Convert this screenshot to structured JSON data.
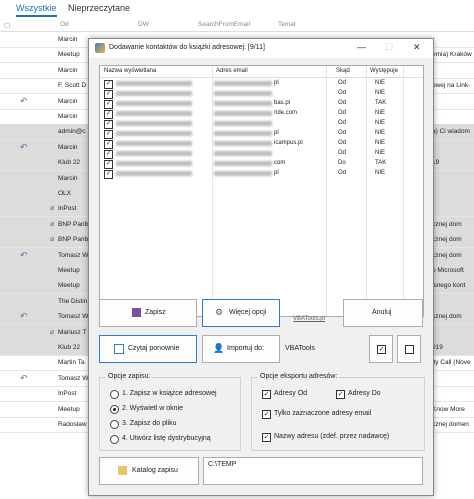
{
  "tabs": {
    "all": "Wszystkie",
    "unread": "Nieprzeczytane"
  },
  "columns": {
    "from": "Od",
    "to": "DW",
    "search_from": "SearchFromEmail",
    "subject": "Temat"
  },
  "rows": [
    {
      "who": "Marcin",
      "right": "",
      "reply": false,
      "clip": false,
      "sel": false
    },
    {
      "who": "Meetup",
      "right": "emia) Kraków",
      "reply": false,
      "clip": false,
      "sel": false
    },
    {
      "who": "Marcin",
      "right": "",
      "reply": false,
      "clip": false,
      "sel": false
    },
    {
      "who": "F. Scott D",
      "right": "owej na Link-",
      "reply": false,
      "clip": false,
      "sel": false
    },
    {
      "who": "Marcin",
      "right": "",
      "reply": true,
      "clip": false,
      "sel": false
    },
    {
      "who": "Marcin",
      "right": "",
      "reply": false,
      "clip": false,
      "sel": false
    },
    {
      "who": "admin@c",
      "right": "a) Ci wiadom",
      "reply": false,
      "clip": false,
      "sel": true
    },
    {
      "who": "Marcin",
      "right": "",
      "reply": true,
      "clip": false,
      "sel": true
    },
    {
      "who": "Klub 22",
      "right": "19",
      "reply": false,
      "clip": false,
      "sel": true
    },
    {
      "who": "Marcin",
      "right": "",
      "reply": false,
      "clip": false,
      "sel": true
    },
    {
      "who": "OLX",
      "right": "",
      "reply": false,
      "clip": false,
      "sel": true
    },
    {
      "who": "InPost",
      "right": "",
      "reply": false,
      "clip": true,
      "sel": true
    },
    {
      "who": "BNP Parib",
      "right": "cznej dom",
      "reply": false,
      "clip": true,
      "sel": true
    },
    {
      "who": "BNP Parib",
      "right": "cznej dom",
      "reply": false,
      "clip": true,
      "sel": true
    },
    {
      "who": "Tomasz W",
      "right": "cznej dom",
      "reply": true,
      "clip": false,
      "sel": true
    },
    {
      "who": "Meetup",
      "right": "o Microsoft",
      "reply": false,
      "clip": false,
      "sel": true
    },
    {
      "who": "Meetup",
      "right": "lsnego kont",
      "reply": false,
      "clip": false,
      "sel": true
    },
    {
      "who": "The Distin",
      "right": "",
      "reply": false,
      "clip": false,
      "sel": true
    },
    {
      "who": "Tomasz W",
      "right": "cznej dom",
      "reply": true,
      "clip": false,
      "sel": true
    },
    {
      "who": "Mariusz T",
      "right": "",
      "reply": false,
      "clip": true,
      "sel": true
    },
    {
      "who": "Klub 22",
      "right": "019",
      "reply": false,
      "clip": false,
      "sel": true
    },
    {
      "who": "Martin Ta",
      "right": "ity Call (Nove",
      "reply": false,
      "clip": false,
      "sel": false
    },
    {
      "who": "Tomasz W",
      "right": "",
      "reply": true,
      "clip": false,
      "sel": false
    },
    {
      "who": "InPost",
      "right": "",
      "reply": false,
      "clip": false,
      "sel": false
    },
    {
      "who": "Meetup",
      "right": "Know More",
      "reply": false,
      "clip": false,
      "sel": false
    },
    {
      "who": "Radosław",
      "right": "cznej domen",
      "reply": false,
      "clip": false,
      "sel": false
    }
  ],
  "dialog": {
    "title": "Dodawanie kontaktów do książki adresowej: [9/11]",
    "list_headers": {
      "name": "Nazwa wyświetlana",
      "email": "Adres email",
      "from": "Skąd",
      "occurs": "Występuje"
    },
    "contacts": [
      {
        "email_tail": "pl",
        "from": "Od",
        "occurs": "NIE"
      },
      {
        "email_tail": "",
        "from": "Od",
        "occurs": "NIE"
      },
      {
        "email_tail": "bas.pl",
        "from": "Od",
        "occurs": "TAK"
      },
      {
        "email_tail": "ride.com",
        "from": "Od",
        "occurs": "NIE"
      },
      {
        "email_tail": "",
        "from": "Od",
        "occurs": "NIE"
      },
      {
        "email_tail": "pl",
        "from": "Od",
        "occurs": "NIE"
      },
      {
        "email_tail": "icampus.pl",
        "from": "Od",
        "occurs": "NIE"
      },
      {
        "email_tail": "",
        "from": "Od",
        "occurs": "NIE"
      },
      {
        "email_tail": "com",
        "from": "Do",
        "occurs": "TAK"
      },
      {
        "email_tail": "pl",
        "from": "Od",
        "occurs": "NIE"
      }
    ],
    "buttons": {
      "save": "Zapisz",
      "more": "Więcej opcji",
      "vba": "VBATools.pl",
      "cancel": "Anuluj",
      "read": "Czytaj ponownie",
      "import": "Importuj do:",
      "vbatools": "VBATools",
      "catalog": "Katalog zapisu"
    },
    "save_options": {
      "title": "Opcje zapisu:",
      "opts": [
        "1. Zapisz w książce adresowej",
        "2. Wyświetl w oknie",
        "3. Zapisz do pliku",
        "4. Utwórz listę dystrybucyjną"
      ],
      "selected": 1
    },
    "export_options": {
      "title": "Opcje eksportu adresów:",
      "from": "Adresy Od",
      "to": "Adresy Do",
      "only_selected": "Tylko zaznaczone adresy email",
      "names": "Nazwy adresu (zdef. przez nadawcę)"
    },
    "path": "C:\\TEMP"
  }
}
